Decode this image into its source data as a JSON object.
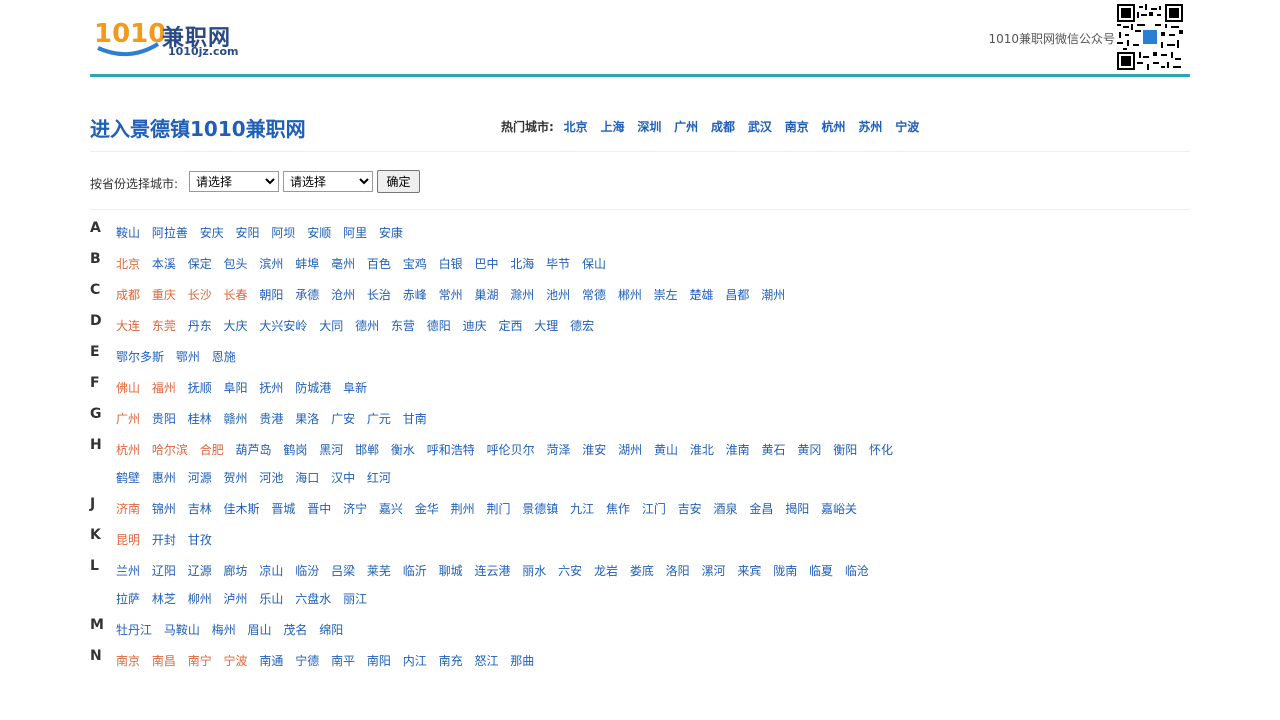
{
  "header": {
    "logo_main": "兼职网",
    "logo_domain": "1010jz.com",
    "logo_number": "1010",
    "wechat_label": "1010兼职网微信公众号"
  },
  "title_row": {
    "title": "进入景德镇1010兼职网",
    "hot_label": "热门城市:",
    "hot_cities": [
      "北京",
      "上海",
      "深圳",
      "广州",
      "成都",
      "武汉",
      "南京",
      "杭州",
      "苏州",
      "宁波"
    ]
  },
  "selector": {
    "label": "按省份选择城市:",
    "province_value": "请选择",
    "city_value": "请选择",
    "confirm_label": "确定"
  },
  "colors": {
    "link": "#1f5fb8",
    "hot": "#e0663a",
    "accent_bar": "#2ba6b5"
  },
  "letters": [
    {
      "letter": "A",
      "cities": [
        {
          "name": "鞍山"
        },
        {
          "name": "阿拉善"
        },
        {
          "name": "安庆"
        },
        {
          "name": "安阳"
        },
        {
          "name": "阿坝"
        },
        {
          "name": "安顺"
        },
        {
          "name": "阿里"
        },
        {
          "name": "安康"
        }
      ]
    },
    {
      "letter": "B",
      "cities": [
        {
          "name": "北京",
          "hot": true
        },
        {
          "name": "本溪"
        },
        {
          "name": "保定"
        },
        {
          "name": "包头"
        },
        {
          "name": "滨州"
        },
        {
          "name": "蚌埠"
        },
        {
          "name": "亳州"
        },
        {
          "name": "百色"
        },
        {
          "name": "宝鸡"
        },
        {
          "name": "白银"
        },
        {
          "name": "巴中"
        },
        {
          "name": "北海"
        },
        {
          "name": "毕节"
        },
        {
          "name": "保山"
        }
      ]
    },
    {
      "letter": "C",
      "cities": [
        {
          "name": "成都",
          "hot": true
        },
        {
          "name": "重庆",
          "hot": true
        },
        {
          "name": "长沙",
          "hot": true
        },
        {
          "name": "长春",
          "hot": true
        },
        {
          "name": "朝阳"
        },
        {
          "name": "承德"
        },
        {
          "name": "沧州"
        },
        {
          "name": "长治"
        },
        {
          "name": "赤峰"
        },
        {
          "name": "常州"
        },
        {
          "name": "巢湖"
        },
        {
          "name": "滁州"
        },
        {
          "name": "池州"
        },
        {
          "name": "常德"
        },
        {
          "name": "郴州"
        },
        {
          "name": "崇左"
        },
        {
          "name": "楚雄"
        },
        {
          "name": "昌都"
        },
        {
          "name": "潮州"
        }
      ]
    },
    {
      "letter": "D",
      "cities": [
        {
          "name": "大连",
          "hot": true
        },
        {
          "name": "东莞",
          "hot": true
        },
        {
          "name": "丹东"
        },
        {
          "name": "大庆"
        },
        {
          "name": "大兴安岭"
        },
        {
          "name": "大同"
        },
        {
          "name": "德州"
        },
        {
          "name": "东营"
        },
        {
          "name": "德阳"
        },
        {
          "name": "迪庆"
        },
        {
          "name": "定西"
        },
        {
          "name": "大理"
        },
        {
          "name": "德宏"
        }
      ]
    },
    {
      "letter": "E",
      "cities": [
        {
          "name": "鄂尔多斯"
        },
        {
          "name": "鄂州"
        },
        {
          "name": "恩施"
        }
      ]
    },
    {
      "letter": "F",
      "cities": [
        {
          "name": "佛山",
          "hot": true
        },
        {
          "name": "福州",
          "hot": true
        },
        {
          "name": "抚顺"
        },
        {
          "name": "阜阳"
        },
        {
          "name": "抚州"
        },
        {
          "name": "防城港"
        },
        {
          "name": "阜新"
        }
      ]
    },
    {
      "letter": "G",
      "cities": [
        {
          "name": "广州",
          "hot": true
        },
        {
          "name": "贵阳"
        },
        {
          "name": "桂林"
        },
        {
          "name": "赣州"
        },
        {
          "name": "贵港"
        },
        {
          "name": "果洛"
        },
        {
          "name": "广安"
        },
        {
          "name": "广元"
        },
        {
          "name": "甘南"
        }
      ]
    },
    {
      "letter": "H",
      "cities": [
        {
          "name": "杭州",
          "hot": true
        },
        {
          "name": "哈尔滨",
          "hot": true
        },
        {
          "name": "合肥",
          "hot": true
        },
        {
          "name": "葫芦岛"
        },
        {
          "name": "鹤岗"
        },
        {
          "name": "黑河"
        },
        {
          "name": "邯郸"
        },
        {
          "name": "衡水"
        },
        {
          "name": "呼和浩特"
        },
        {
          "name": "呼伦贝尔"
        },
        {
          "name": "菏泽"
        },
        {
          "name": "淮安"
        },
        {
          "name": "湖州"
        },
        {
          "name": "黄山"
        },
        {
          "name": "淮北"
        },
        {
          "name": "淮南"
        },
        {
          "name": "黄石"
        },
        {
          "name": "黄冈"
        },
        {
          "name": "衡阳"
        },
        {
          "name": "怀化"
        },
        {
          "name": "鹤壁"
        },
        {
          "name": "惠州"
        },
        {
          "name": "河源"
        },
        {
          "name": "贺州"
        },
        {
          "name": "河池"
        },
        {
          "name": "海口"
        },
        {
          "name": "汉中"
        },
        {
          "name": "红河"
        }
      ]
    },
    {
      "letter": "J",
      "cities": [
        {
          "name": "济南",
          "hot": true
        },
        {
          "name": "锦州"
        },
        {
          "name": "吉林"
        },
        {
          "name": "佳木斯"
        },
        {
          "name": "晋城"
        },
        {
          "name": "晋中"
        },
        {
          "name": "济宁"
        },
        {
          "name": "嘉兴"
        },
        {
          "name": "金华"
        },
        {
          "name": "荆州"
        },
        {
          "name": "荆门"
        },
        {
          "name": "景德镇"
        },
        {
          "name": "九江"
        },
        {
          "name": "焦作"
        },
        {
          "name": "江门"
        },
        {
          "name": "吉安"
        },
        {
          "name": "酒泉"
        },
        {
          "name": "金昌"
        },
        {
          "name": "揭阳"
        },
        {
          "name": "嘉峪关"
        }
      ]
    },
    {
      "letter": "K",
      "cities": [
        {
          "name": "昆明",
          "hot": true
        },
        {
          "name": "开封"
        },
        {
          "name": "甘孜"
        }
      ]
    },
    {
      "letter": "L",
      "cities": [
        {
          "name": "兰州"
        },
        {
          "name": "辽阳"
        },
        {
          "name": "辽源"
        },
        {
          "name": "廊坊"
        },
        {
          "name": "凉山"
        },
        {
          "name": "临汾"
        },
        {
          "name": "吕梁"
        },
        {
          "name": "莱芜"
        },
        {
          "name": "临沂"
        },
        {
          "name": "聊城"
        },
        {
          "name": "连云港"
        },
        {
          "name": "丽水"
        },
        {
          "name": "六安"
        },
        {
          "name": "龙岩"
        },
        {
          "name": "娄底"
        },
        {
          "name": "洛阳"
        },
        {
          "name": "漯河"
        },
        {
          "name": "来宾"
        },
        {
          "name": "陇南"
        },
        {
          "name": "临夏"
        },
        {
          "name": "临沧"
        },
        {
          "name": "拉萨"
        },
        {
          "name": "林芝"
        },
        {
          "name": "柳州"
        },
        {
          "name": "泸州"
        },
        {
          "name": "乐山"
        },
        {
          "name": "六盘水"
        },
        {
          "name": "丽江"
        }
      ]
    },
    {
      "letter": "M",
      "cities": [
        {
          "name": "牡丹江"
        },
        {
          "name": "马鞍山"
        },
        {
          "name": "梅州"
        },
        {
          "name": "眉山"
        },
        {
          "name": "茂名"
        },
        {
          "name": "绵阳"
        }
      ]
    },
    {
      "letter": "N",
      "cities": [
        {
          "name": "南京",
          "hot": true
        },
        {
          "name": "南昌",
          "hot": true
        },
        {
          "name": "南宁",
          "hot": true
        },
        {
          "name": "宁波",
          "hot": true
        },
        {
          "name": "南通"
        },
        {
          "name": "宁德"
        },
        {
          "name": "南平"
        },
        {
          "name": "南阳"
        },
        {
          "name": "内江"
        },
        {
          "name": "南充"
        },
        {
          "name": "怒江"
        },
        {
          "name": "那曲"
        }
      ]
    }
  ]
}
